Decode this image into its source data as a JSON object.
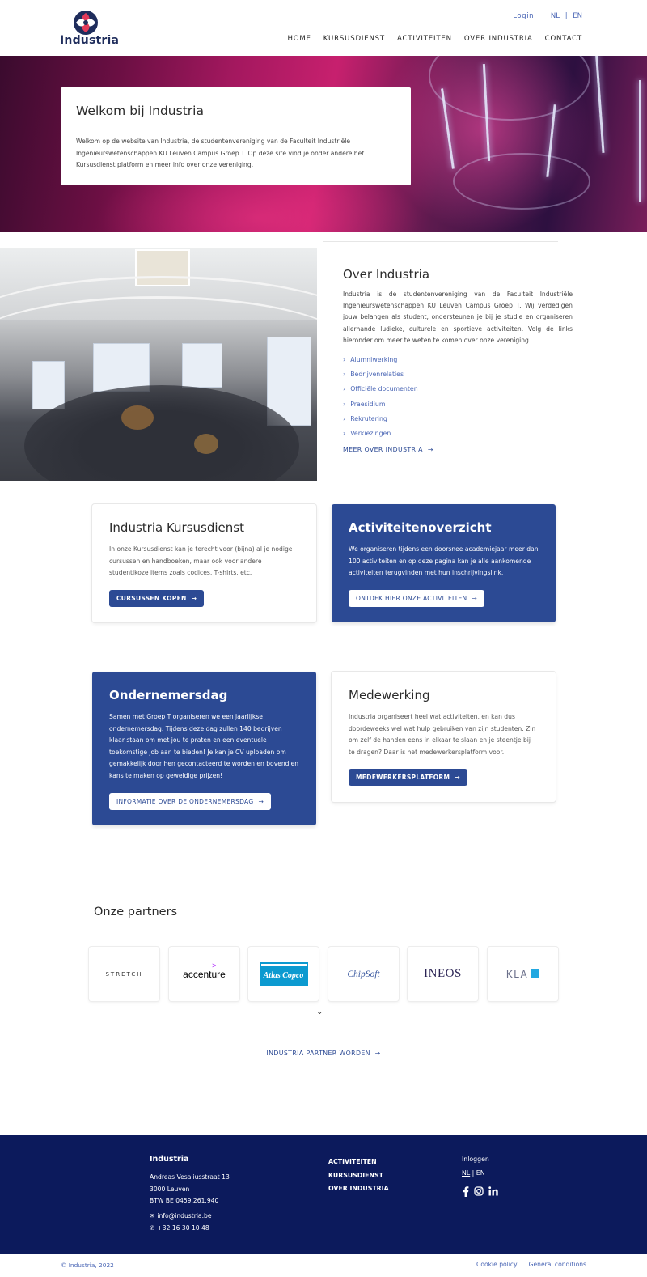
{
  "header": {
    "logo_text": "Industria",
    "login": "Login",
    "lang_nl": "NL",
    "lang_sep": "|",
    "lang_en": "EN",
    "nav": [
      "HOME",
      "KURSUSDIENST",
      "ACTIVITEITEN",
      "OVER INDUSTRIA",
      "CONTACT"
    ]
  },
  "hero": {
    "title": "Welkom bij Industria",
    "text": "Welkom op de website van Industria, de studentenvereniging van de Faculteit Industriële Ingenieurswetenschappen KU Leuven Campus Groep T. Op deze site vind je onder andere het Kursusdienst platform en meer info over onze vereniging."
  },
  "about": {
    "title": "Over Industria",
    "text": "Industria is de studentenvereniging van de Faculteit Industriële Ingenieurswetenschappen KU Leuven Campus Groep T. Wij verdedigen jouw belangen als student, ondersteunen je bij je studie en organiseren allerhande ludieke, culturele en sportieve activiteiten. Volg de links hieronder om meer te weten te komen over onze vereniging.",
    "links": [
      "Alumniwerking",
      "Bedrijvenrelaties",
      "Officiële documenten",
      "Praesidium",
      "Rekrutering",
      "Verkiezingen"
    ],
    "more": "MEER OVER INDUSTRIA"
  },
  "cards": {
    "kursusdienst": {
      "title": "Industria Kursusdienst",
      "text": "In onze Kursusdienst kan je terecht voor (bijna) al je nodige cursussen en handboeken, maar ook voor andere studentikoze items zoals codices, T-shirts, etc.",
      "button": "CURSUSSEN KOPEN"
    },
    "activiteiten": {
      "title": "Activiteitenoverzicht",
      "text": "We organiseren tijdens een doorsnee academiejaar meer dan 100 activiteiten en op deze pagina kan je alle aankomende activiteiten terugvinden met hun inschrijvingslink.",
      "button": "ONTDEK HIER ONZE ACTIVITEITEN"
    },
    "ondernemersdag": {
      "title": "Ondernemersdag",
      "text": "Samen met Groep T organiseren we een jaarlijkse ondernemersdag. Tijdens deze dag zullen 140 bedrijven klaar staan om met jou te praten en een eventuele toekomstige job aan te bieden! Je kan je CV uploaden om gemakkelijk door hen gecontacteerd te worden en bovendien kans te maken op geweldige prijzen!",
      "button": "INFORMATIE OVER DE ONDERNEMERSDAG"
    },
    "medewerking": {
      "title": "Medewerking",
      "text": "Industria organiseert heel wat activiteiten, en kan dus doordeweeks wel wat hulp gebruiken van zijn studenten. Zin om zelf de handen eens in elkaar te slaan en je steentje bij te dragen? Daar is het medewerkersplatform voor.",
      "button": "MEDEWERKERSPLATFORM"
    }
  },
  "partners": {
    "title": "Onze partners",
    "logos": [
      "STRETCH",
      "accenture",
      "Atlas Copco",
      "ChipSoft",
      "INEOS",
      "KLA"
    ],
    "cta": "INDUSTRIA PARTNER WORDEN"
  },
  "footer": {
    "name": "Industria",
    "address1": "Andreas Vesaliusstraat 13",
    "address2": "3000 Leuven",
    "vat": "BTW BE 0459.261.940",
    "email": "info@industria.be",
    "phone": "+32 16 30 10 48",
    "links": [
      "ACTIVITEITEN",
      "KURSUSDIENST",
      "OVER INDUSTRIA"
    ],
    "login": "Inloggen",
    "lang_nl": "NL",
    "lang_sep": "|",
    "lang_en": "EN",
    "copyright": "© Industria, 2022",
    "cookie": "Cookie policy",
    "conditions": "General conditions"
  },
  "colors": {
    "primary": "#2c4a94",
    "footer": "#0c1a5c",
    "link": "#4a66b5"
  }
}
